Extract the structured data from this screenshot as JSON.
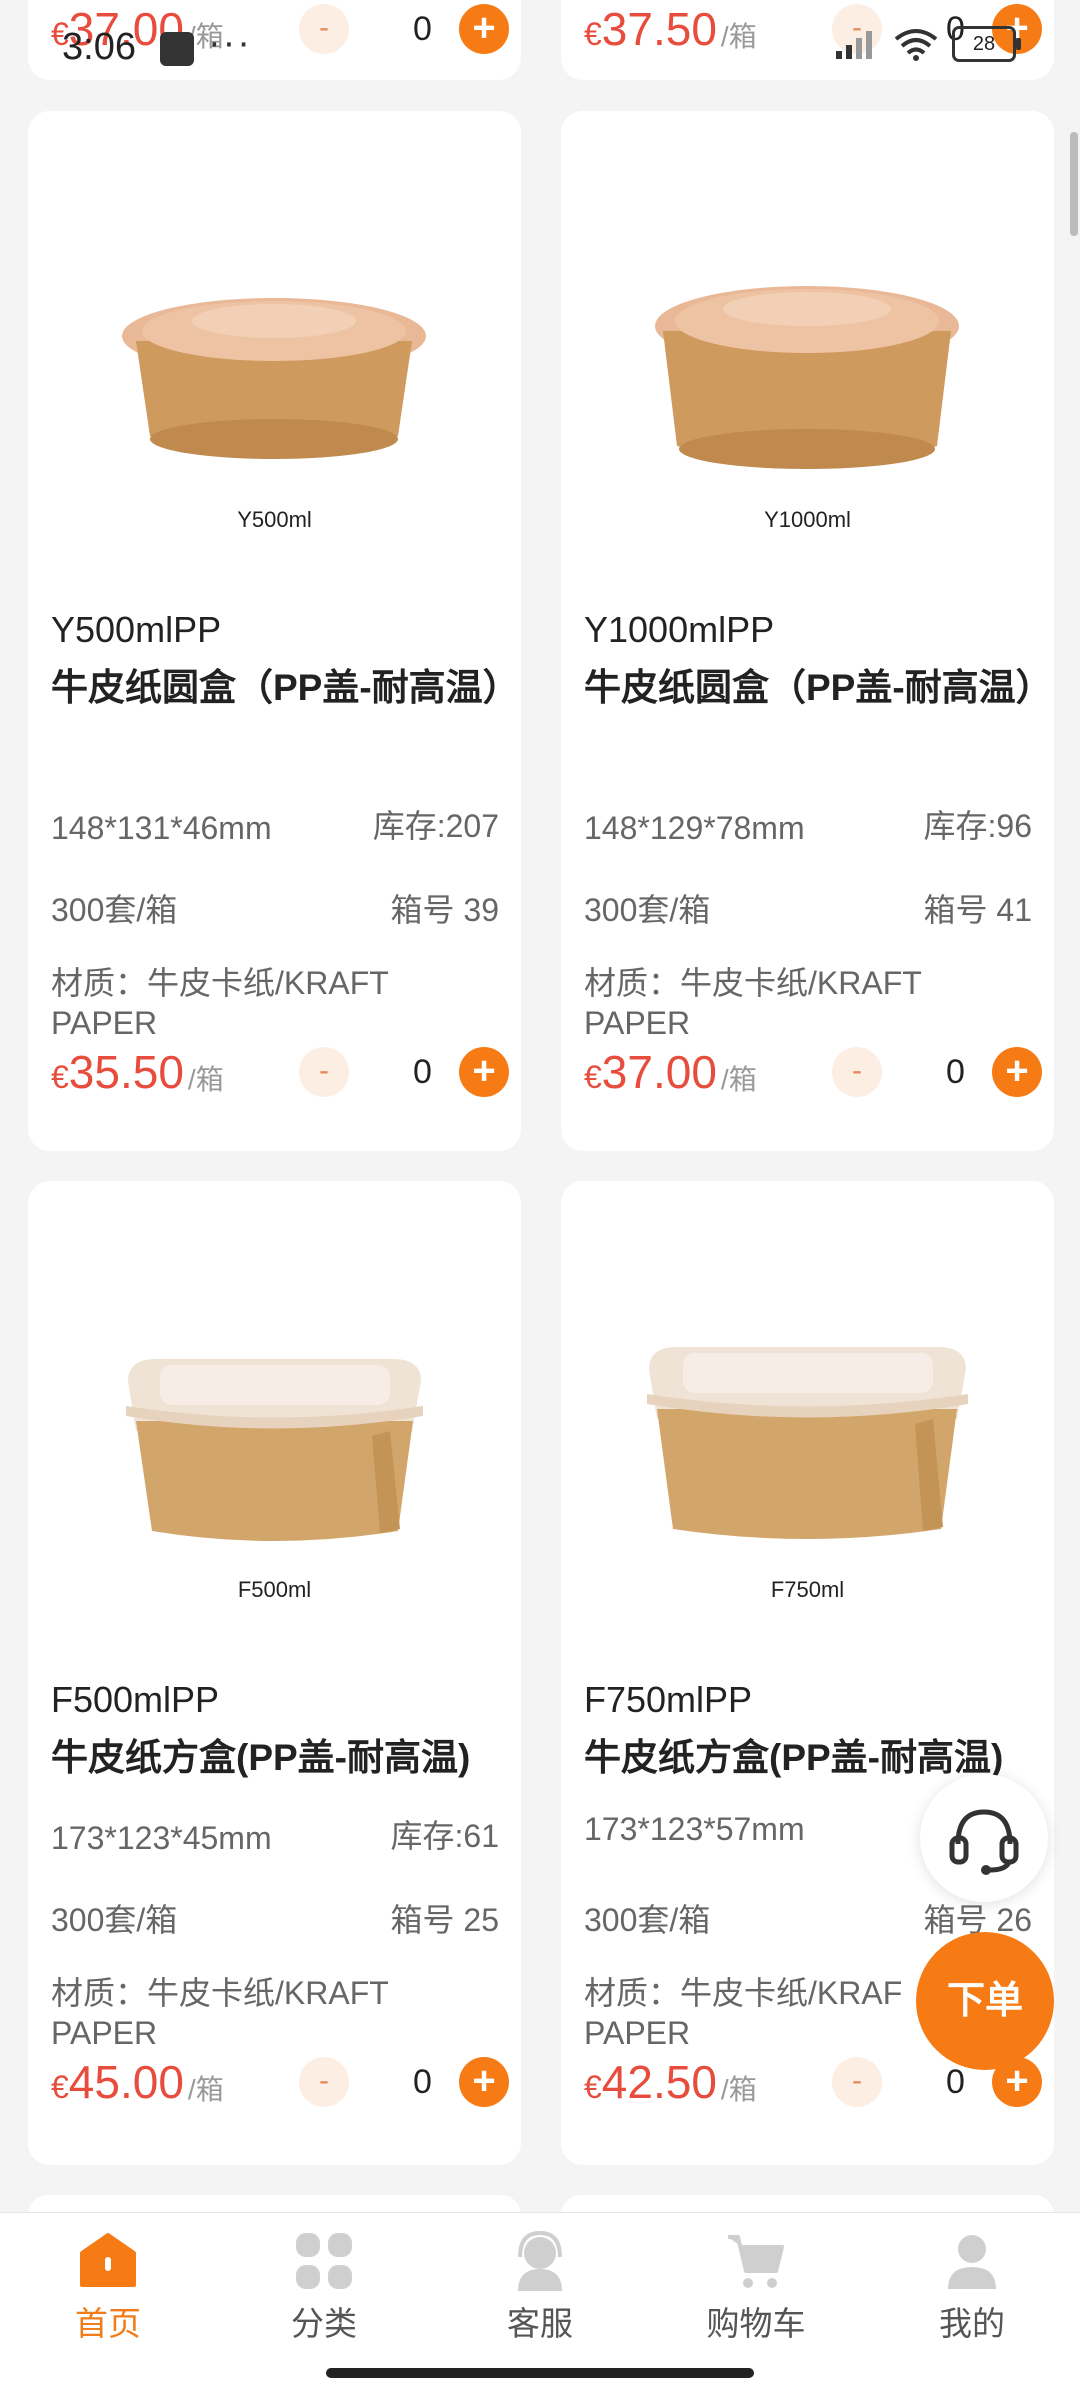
{
  "status_bar": {
    "time": "3:06",
    "dots": "···",
    "battery": "28"
  },
  "top_partial": [
    {
      "price_currency": "€",
      "price": "37.00",
      "unit": "/箱",
      "minus": "-",
      "qty": "0",
      "plus": "+"
    },
    {
      "price_currency": "€",
      "price": "37.50",
      "unit": "/箱",
      "minus": "-",
      "qty": "0",
      "plus": "+"
    }
  ],
  "products": [
    {
      "img_label": "Y500ml",
      "title_line1": "Y500mlPP",
      "title_line2": "牛皮纸圆盒（PP盖-耐高温）",
      "dimensions": "148*131*46mm",
      "stock": "库存:207",
      "pack": "300套/箱",
      "box_no": "箱号 39",
      "material": "材质：牛皮卡纸/KRAFT PAPER",
      "price_currency": "€",
      "price": "35.50",
      "unit": "/箱",
      "minus": "-",
      "qty": "0",
      "plus": "+"
    },
    {
      "img_label": "Y1000ml",
      "title_line1": "Y1000mlPP",
      "title_line2": "牛皮纸圆盒（PP盖-耐高温）",
      "dimensions": "148*129*78mm",
      "stock": "库存:96",
      "pack": "300套/箱",
      "box_no": "箱号 41",
      "material": "材质：牛皮卡纸/KRAFT PAPER",
      "price_currency": "€",
      "price": "37.00",
      "unit": "/箱",
      "minus": "-",
      "qty": "0",
      "plus": "+"
    },
    {
      "img_label": "F500ml",
      "title_line1": "F500mlPP",
      "title_line2": "牛皮纸方盒(PP盖-耐高温)",
      "dimensions": "173*123*45mm",
      "stock": "库存:61",
      "pack": "300套/箱",
      "box_no": "箱号 25",
      "material": "材质：牛皮卡纸/KRAFT PAPER",
      "price_currency": "€",
      "price": "45.00",
      "unit": "/箱",
      "minus": "-",
      "qty": "0",
      "plus": "+"
    },
    {
      "img_label": "F750ml",
      "title_line1": "F750mlPP",
      "title_line2": "牛皮纸方盒(PP盖-耐高温)",
      "dimensions": "173*123*57mm",
      "stock": "",
      "pack": "300套/箱",
      "box_no": "箱号 26",
      "material": "材质：牛皮卡纸/KRAF",
      "material_line2": "PAPER",
      "price_currency": "€",
      "price": "42.50",
      "unit": "/箱",
      "minus": "-",
      "qty": "0",
      "plus": "+"
    }
  ],
  "float_order_label": "下单",
  "tabs": [
    {
      "label": "首页",
      "icon": "home-icon"
    },
    {
      "label": "分类",
      "icon": "category-icon"
    },
    {
      "label": "客服",
      "icon": "customer-service-icon"
    },
    {
      "label": "购物车",
      "icon": "cart-icon"
    },
    {
      "label": "我的",
      "icon": "profile-icon"
    }
  ],
  "colors": {
    "accent": "#f77b15",
    "price": "#e74c3c",
    "active_tab": "#f07d1a"
  }
}
